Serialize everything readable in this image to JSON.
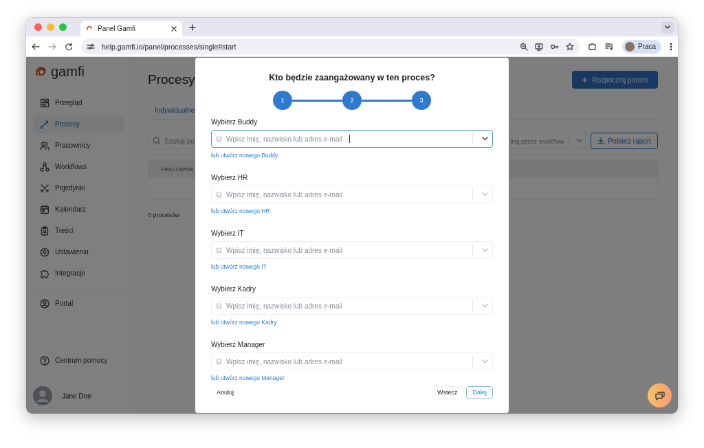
{
  "browser": {
    "tab_title": "Panel Gamfi",
    "url": "help.gamfi.io/panel/processes/single#start",
    "profile": "Praca"
  },
  "sidebar": {
    "logo": "gamfi",
    "items": [
      {
        "label": "Przegląd",
        "selected": false
      },
      {
        "label": "Procesy",
        "selected": true
      },
      {
        "label": "Pracownicy",
        "selected": false
      },
      {
        "label": "Workflows",
        "selected": false
      },
      {
        "label": "Pojedynki",
        "selected": false
      },
      {
        "label": "Kalendarz",
        "selected": false
      },
      {
        "label": "Treści",
        "selected": false
      },
      {
        "label": "Ustawienia",
        "selected": false
      },
      {
        "label": "Integracje",
        "selected": false
      }
    ],
    "secondary_items": [
      {
        "label": "Portal",
        "selected": false
      }
    ],
    "help": "Centrum pomocy",
    "user": {
      "name": "Jane Doe"
    }
  },
  "main": {
    "title": "Procesy",
    "start_button": "Rozpocznij proces",
    "tabs": [
      {
        "label": "Indywidualne",
        "selected": true
      }
    ],
    "search": {
      "placeholder": "Szukaj po"
    },
    "filter": {
      "placeholder": "truj przez workflow"
    },
    "report_button": "Pobierz raport",
    "table": {
      "columns": [
        "PRACOWNIK"
      ]
    },
    "count": "0 procesów"
  },
  "modal": {
    "title": "Kto będzie zaangażowany w ten proces?",
    "steps": [
      "1",
      "2",
      "3"
    ],
    "fields": [
      {
        "label": "Wybierz Buddy",
        "placeholder": "Wpisz imię, nazwisko lub adres e-mail",
        "focused": true,
        "create_link": "lub utwórz nowego Buddy"
      },
      {
        "label": "Wybierz HR",
        "placeholder": "Wpisz imię, nazwisko lub adres e-mail",
        "focused": false,
        "create_link": "lub utwórz nowego HR"
      },
      {
        "label": "Wybierz IT",
        "placeholder": "Wpisz imię, nazwisko lub adres e-mail",
        "focused": false,
        "create_link": "lub utwórz nowego IT"
      },
      {
        "label": "Wybierz Kadry",
        "placeholder": "Wpisz imię, nazwisko lub adres e-mail",
        "focused": false,
        "create_link": "lub utwórz nowego Kadry"
      },
      {
        "label": "Wybierz Manager",
        "placeholder": "Wpisz imię, nazwisko lub adres e-mail",
        "focused": false,
        "create_link": "lub utwórz nowego Manager"
      }
    ],
    "cancel_button": "Anuluj",
    "back_button": "Wstecz",
    "next_button": "Dalej"
  }
}
